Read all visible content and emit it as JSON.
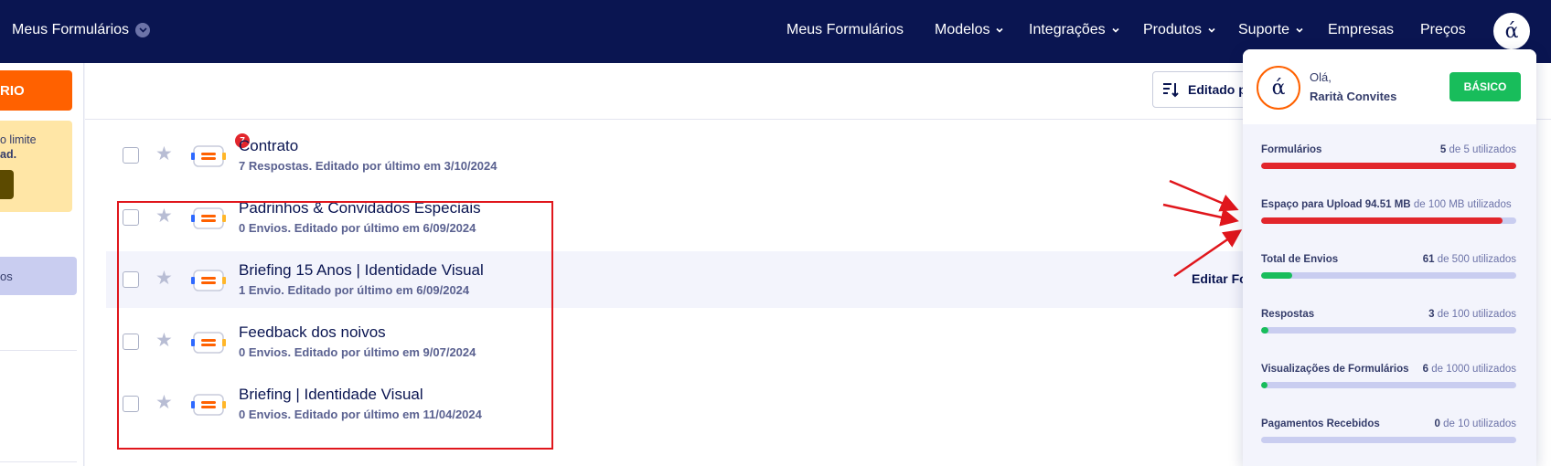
{
  "topbar": {
    "brand": "Meus Formulários",
    "nav": [
      {
        "label": "Meus Formulários",
        "has_chevron": false
      },
      {
        "label": "Modelos",
        "has_chevron": true
      },
      {
        "label": "Integrações",
        "has_chevron": true
      },
      {
        "label": "Produtos",
        "has_chevron": true
      },
      {
        "label": "Suporte",
        "has_chevron": true
      },
      {
        "label": "Empresas",
        "has_chevron": false
      },
      {
        "label": "Preços",
        "has_chevron": false
      }
    ],
    "avatar_glyph": "ά"
  },
  "sidebar": {
    "create_button": "RIO",
    "limit_line1": "o limite",
    "limit_line2": "ad.",
    "active_item": "os"
  },
  "toolbar": {
    "sort_label": "Editado po"
  },
  "forms": [
    {
      "title": "Contrato",
      "meta": "7 Respostas. Editado por último em 3/10/2024",
      "badge": "7"
    },
    {
      "title": "Padrinhos & Convidados Especiais",
      "meta": "0 Envios. Editado por último em 6/09/2024",
      "badge": null
    },
    {
      "title": "Briefing 15 Anos | Identidade Visual",
      "meta": "1 Envio. Editado por último em 6/09/2024",
      "badge": null,
      "highlighted": true,
      "action": "Editar Fo"
    },
    {
      "title": "Feedback dos noivos",
      "meta": "0 Envios. Editado por último em 9/07/2024",
      "badge": null
    },
    {
      "title": "Briefing | Identidade Visual",
      "meta": "0 Envios. Editado por último em 11/04/2024",
      "badge": null
    }
  ],
  "account_panel": {
    "greeting": "Olá,",
    "name": "Rarità Convites",
    "plan": "BÁSICO",
    "avatar_glyph": "ά",
    "stats": [
      {
        "label": "Formulários",
        "label_extra": "",
        "used": "5",
        "total_text": "de 5 utilizados",
        "fraction": 1.0,
        "color": "#e2262c"
      },
      {
        "label": "Espaço para Upload 94.51 MB",
        "label_extra": "de 100 MB utilizados",
        "used": "",
        "total_text": "",
        "fraction": 0.9451,
        "color": "#e2262c"
      },
      {
        "label": "Total de Envios",
        "label_extra": "",
        "used": "61",
        "total_text": "de 500 utilizados",
        "fraction": 0.122,
        "color": "#18bd5b"
      },
      {
        "label": "Respostas",
        "label_extra": "",
        "used": "3",
        "total_text": "de 100 utilizados",
        "fraction": 0.03,
        "color": "#18bd5b"
      },
      {
        "label": "Visualizações de Formulários",
        "label_extra": "",
        "used": "6",
        "total_text": "de 1000 utilizados",
        "fraction": 0.006,
        "color": "#18bd5b"
      },
      {
        "label": "Pagamentos Recebidos",
        "label_extra": "",
        "used": "0",
        "total_text": "de 10 utilizados",
        "fraction": 0.0,
        "color": "#18bd5b"
      }
    ]
  },
  "colors": {
    "navy": "#0a1551",
    "orange": "#ff6100",
    "annotation_red": "#e0161c"
  }
}
